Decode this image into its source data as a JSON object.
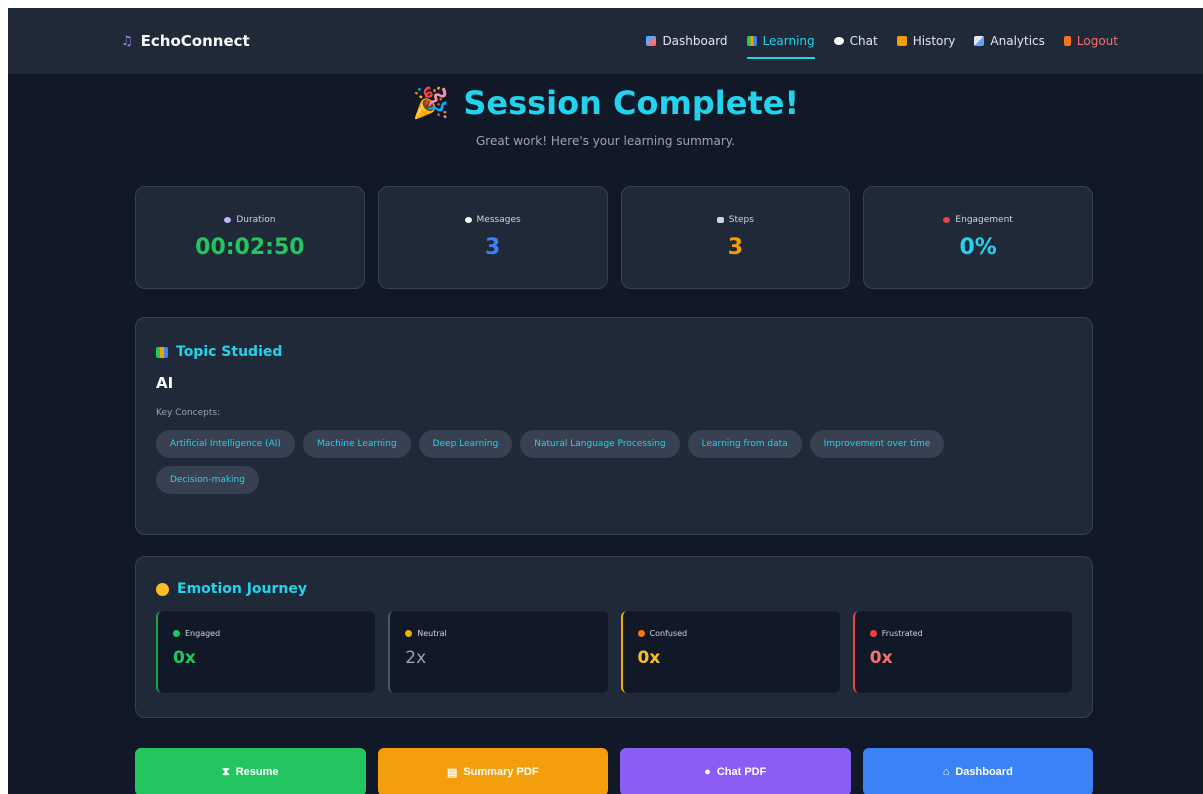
{
  "brand": {
    "name": "EchoConnect"
  },
  "nav": {
    "items": [
      {
        "label": "Dashboard",
        "icon": "chart-icon",
        "color": "#60a5fa"
      },
      {
        "label": "Learning",
        "icon": "books-icon",
        "color": "#fbbf24"
      },
      {
        "label": "Chat",
        "icon": "speech-bubble-icon",
        "color": "#e5e7eb"
      },
      {
        "label": "History",
        "icon": "scroll-icon",
        "color": "#f59e0b"
      },
      {
        "label": "Analytics",
        "icon": "bar-chart-icon",
        "color": "#93c5fd"
      },
      {
        "label": "Logout",
        "icon": "door-icon",
        "color": "#f97316"
      }
    ],
    "active": "Learning"
  },
  "header": {
    "title": "Session Complete!",
    "subtitle": "Great work! Here's your learning summary."
  },
  "stats": [
    {
      "label": "Duration",
      "value": "00:02:50",
      "color": "#22c55e",
      "icon": "timer-icon",
      "icon_color": "#c4b5fd"
    },
    {
      "label": "Messages",
      "value": "3",
      "color": "#3b82f6",
      "icon": "speech-bubble-icon",
      "icon_color": "#e5e7eb"
    },
    {
      "label": "Steps",
      "value": "3",
      "color": "#f59e0b",
      "icon": "clipboard-icon",
      "icon_color": "#cbd5e1"
    },
    {
      "label": "Engagement",
      "value": "0%",
      "color": "#22d3ee",
      "icon": "target-icon",
      "icon_color": "#ef4444"
    }
  ],
  "topic": {
    "title": "Topic Studied",
    "name": "AI",
    "concepts_label": "Key Concepts:",
    "concepts": [
      "Artificial Intelligence (AI)",
      "Machine Learning",
      "Deep Learning",
      "Natural Language Processing",
      "Learning from data",
      "Improvement over time",
      "Decision-making"
    ]
  },
  "emotion": {
    "title": "Emotion Journey",
    "items": [
      {
        "label": "Engaged",
        "value": "0x",
        "color": "#22c55e",
        "value_color": "#22c55e"
      },
      {
        "label": "Neutral",
        "value": "2x",
        "color": "#eab308",
        "value_color": "#9ca3af",
        "border": "#4b5563"
      },
      {
        "label": "Confused",
        "value": "0x",
        "color": "#f97316",
        "value_color": "#fbbf24",
        "border": "#eab308"
      },
      {
        "label": "Frustrated",
        "value": "0x",
        "color": "#ef4444",
        "value_color": "#f87171",
        "border": "#ef4444"
      }
    ]
  },
  "actions": [
    {
      "label": "Resume",
      "color": "#22c55e",
      "icon": "hourglass-icon"
    },
    {
      "label": "Summary PDF",
      "color": "#f59e0b",
      "icon": "document-icon"
    },
    {
      "label": "Chat PDF",
      "color": "#8b5cf6",
      "icon": "speech-bubble-icon"
    },
    {
      "label": "Dashboard",
      "color": "#3b82f6",
      "icon": "home-icon"
    }
  ]
}
